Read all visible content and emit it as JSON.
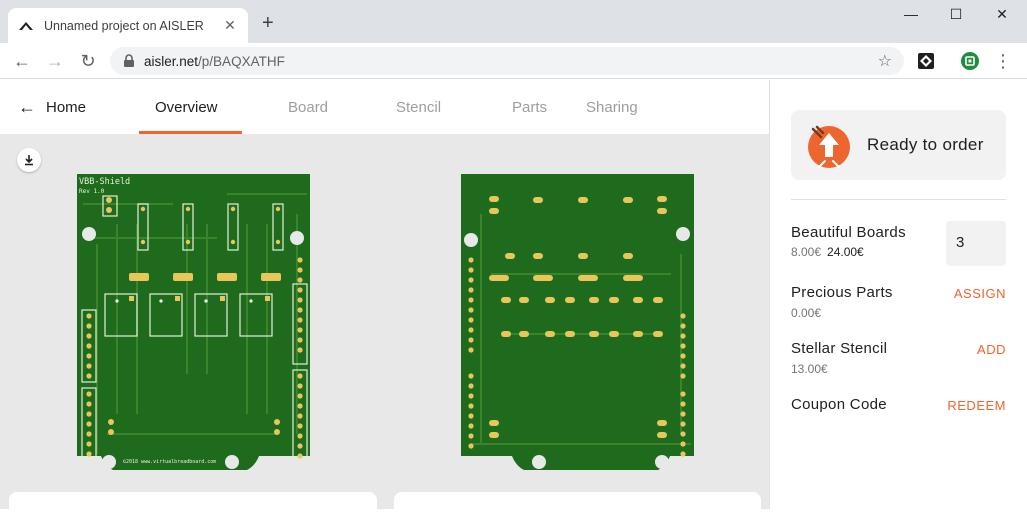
{
  "browser": {
    "tab_title": "Unnamed project on AISLER",
    "new_tab_icon": "+",
    "url_domain": "aisler.net",
    "url_path": "/p/BAQXATHF"
  },
  "app": {
    "home_label": "Home",
    "tabs": [
      "Overview",
      "Board",
      "Stencil",
      "Parts",
      "Sharing"
    ],
    "active_tab": "Overview"
  },
  "preview": {
    "board_name": "VBB-Shield",
    "board_rev": "Rev 1.0",
    "copyright": "©2018 www.virtualbreadboard.com"
  },
  "order": {
    "status": "Ready to order",
    "items": [
      {
        "name": "Beautiful Boards",
        "unit_price": "8.00€",
        "total": "24.00€",
        "quantity": "3"
      },
      {
        "name": "Precious Parts",
        "price": "0.00€",
        "action": "ASSIGN"
      },
      {
        "name": "Stellar Stencil",
        "price": "13.00€",
        "action": "ADD"
      },
      {
        "name": "Coupon Code",
        "action": "REDEEM"
      }
    ]
  },
  "colors": {
    "accent": "#ef6530",
    "pcb_green": "#1e6b1e",
    "copper_pad": "#e8c65a"
  }
}
